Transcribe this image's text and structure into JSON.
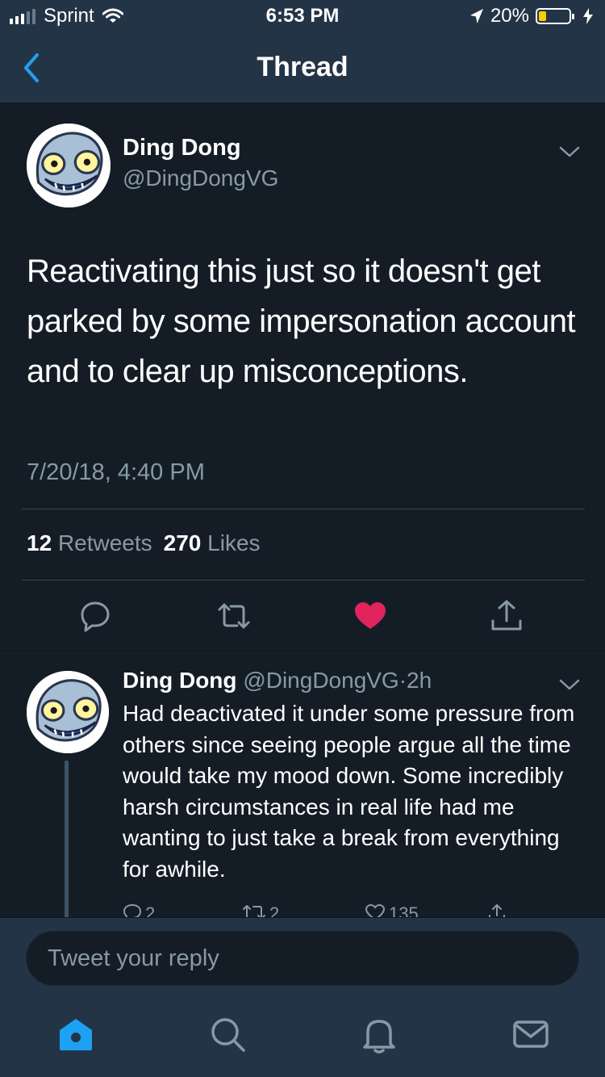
{
  "status_bar": {
    "carrier": "Sprint",
    "time": "6:53 PM",
    "battery": "20%",
    "battery_level": 0.2
  },
  "nav": {
    "title": "Thread",
    "back_icon": "chevron-left-icon"
  },
  "main_tweet": {
    "name": "Ding Dong",
    "handle": "@DingDongVG",
    "text": "Reactivating this just so it doesn't get parked by some impersonation account and to clear up misconceptions.",
    "timestamp": "7/20/18, 4:40 PM",
    "retweets_count": "12",
    "retweets_label": "Retweets",
    "likes_count": "270",
    "likes_label": "Likes",
    "liked": true,
    "like_color": "#e0245e"
  },
  "reply_tweet": {
    "name": "Ding Dong",
    "handle": "@DingDongVG",
    "separator": "·",
    "age": "2h",
    "text": "Had deactivated it under some pressure from others since seeing people argue all the time would take my mood down. Some incredibly harsh circumstances in real life had me wanting to just take a break from everything for awhile.",
    "replies": "2",
    "retweets": "2",
    "likes": "135"
  },
  "composer": {
    "placeholder": "Tweet your reply"
  },
  "tabbar": {
    "items": [
      "home-icon",
      "search-icon",
      "notifications-icon",
      "messages-icon"
    ],
    "active_color": "#1da1f2"
  },
  "colors": {
    "background": "#141d26",
    "chrome": "#243447",
    "secondary_text": "#8899a6",
    "accent": "#1da1f2"
  }
}
